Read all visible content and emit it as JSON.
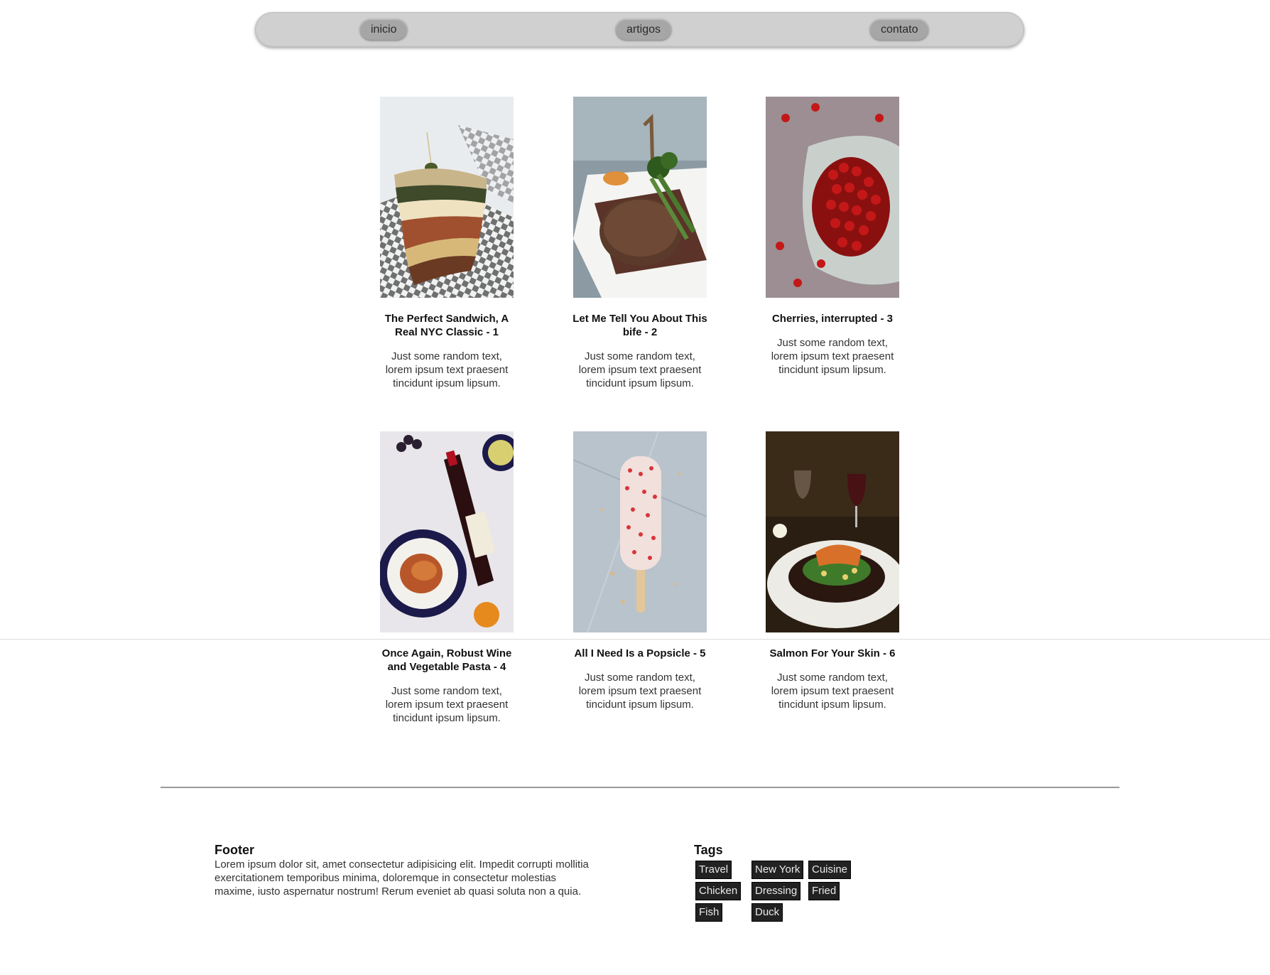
{
  "nav": {
    "items": [
      {
        "label": "inicio"
      },
      {
        "label": "artigos"
      },
      {
        "label": "contato"
      }
    ]
  },
  "posts": [
    {
      "title": "The Perfect Sandwich, A Real NYC Classic - 1",
      "text": "Just some random text, lorem ipsum text praesent tincidunt ipsum lipsum.",
      "image": "sandwich-photo"
    },
    {
      "title": "Let Me Tell You About This bife - 2",
      "text": "Just some random text, lorem ipsum text praesent tincidunt ipsum lipsum.",
      "image": "steak-photo"
    },
    {
      "title": "Cherries, interrupted - 3",
      "text": "Just some random text, lorem ipsum text praesent tincidunt ipsum lipsum.",
      "image": "cherries-photo"
    },
    {
      "title": "Once Again, Robust Wine and Vegetable Pasta - 4",
      "text": "Just some random text, lorem ipsum text praesent tincidunt ipsum lipsum.",
      "image": "wine-pasta-photo"
    },
    {
      "title": "All I Need Is a Popsicle - 5",
      "text": "Just some random text, lorem ipsum text praesent tincidunt ipsum lipsum.",
      "image": "popsicle-photo"
    },
    {
      "title": "Salmon For Your Skin - 6",
      "text": "Just some random text, lorem ipsum text praesent tincidunt ipsum lipsum.",
      "image": "salmon-photo"
    }
  ],
  "footer": {
    "heading": "Footer",
    "text": "Lorem ipsum dolor sit, amet consectetur adipisicing elit. Impedit corrupti mollitia exercitationem temporibus minima, doloremque in consectetur molestias maxime, iusto aspernatur nostrum! Rerum eveniet ab quasi soluta non a quia."
  },
  "tags": {
    "heading": "Tags",
    "items": [
      "Travel",
      "New York",
      "Cuisine",
      "Chicken",
      "Dressing",
      "Fried",
      "Fish",
      "Duck"
    ]
  }
}
